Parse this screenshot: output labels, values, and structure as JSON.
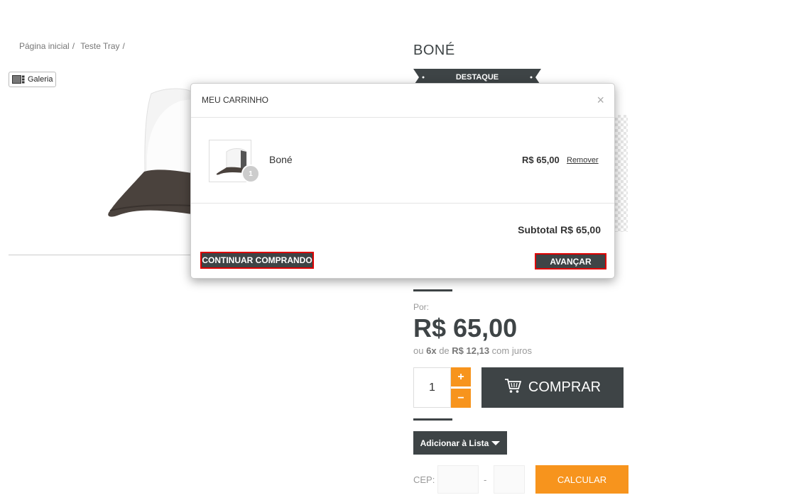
{
  "breadcrumb": {
    "items": [
      "Página inicial",
      "Teste Tray"
    ],
    "separator": "/"
  },
  "gallery": {
    "label": "Galeria"
  },
  "product": {
    "title": "BONÉ",
    "badge": "DESTAQUE",
    "price_prefix": "Por:",
    "price": "R$ 65,00",
    "installments": {
      "prefix": "ou",
      "count": "6x",
      "connector": "de",
      "amount": "R$ 12,13",
      "suffix": "com juros"
    },
    "quantity": "1",
    "qty_plus": "+",
    "qty_minus": "−",
    "buy_label": "COMPRAR",
    "wishlist_label": "Adicionar à Lista",
    "cep_label": "CEP:",
    "cep_dash": "-",
    "calc_label": "CALCULAR"
  },
  "cart_modal": {
    "title": "MEU CARRINHO",
    "close": "×",
    "items": [
      {
        "name": "Boné",
        "quantity": "1",
        "price": "R$ 65,00",
        "remove_label": "Remover"
      }
    ],
    "subtotal_label": "Subtotal",
    "subtotal_value": "R$ 65,00",
    "continue_label": "CONTINUAR COMPRANDO",
    "advance_label": "AVANÇAR"
  },
  "colors": {
    "dark": "#3e4446",
    "orange": "#f7941d",
    "highlight_border": "#dd0000"
  }
}
